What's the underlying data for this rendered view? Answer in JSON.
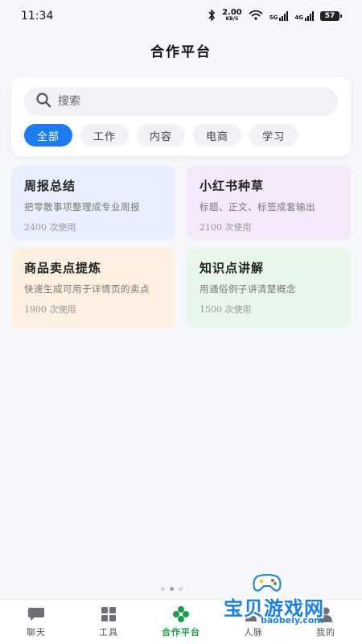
{
  "status_bar": {
    "time": "11:34",
    "net_speed": "2.00",
    "net_unit": "KB/S",
    "net_5g": "5G",
    "net_4g": "4G",
    "battery": "57"
  },
  "header": {
    "title": "合作平台"
  },
  "search": {
    "placeholder": "搜索",
    "value": ""
  },
  "filters": [
    {
      "label": "全部",
      "active": true
    },
    {
      "label": "工作",
      "active": false
    },
    {
      "label": "内容",
      "active": false
    },
    {
      "label": "电商",
      "active": false
    },
    {
      "label": "学习",
      "active": false
    }
  ],
  "cards": [
    {
      "title": "周报总结",
      "desc": "把零散事项整理成专业周报",
      "uses": "2400 次使用",
      "bg": "#e9efff"
    },
    {
      "title": "小红书种草",
      "desc": "标题、正文、标签成套输出",
      "uses": "2100 次使用",
      "bg": "#f3e9fb"
    },
    {
      "title": "商品卖点提炼",
      "desc": "快速生成可用于详情页的卖点",
      "uses": "1900 次使用",
      "bg": "#fdf0e1"
    },
    {
      "title": "知识点讲解",
      "desc": "用通俗例子讲清楚概念",
      "uses": "1500 次使用",
      "bg": "#e8f6ec"
    }
  ],
  "tabbar": [
    {
      "label": "聊天",
      "icon": "chat-icon",
      "active": false
    },
    {
      "label": "工具",
      "icon": "grid-icon",
      "active": false
    },
    {
      "label": "合作平台",
      "icon": "clover-icon",
      "active": true
    },
    {
      "label": "人脉",
      "icon": "people-icon",
      "active": false
    },
    {
      "label": "我的",
      "icon": "user-icon",
      "active": false
    }
  ],
  "watermark": {
    "text": "宝贝游戏网",
    "url": "baobeiy.com"
  },
  "colors": {
    "accent": "#1f7cf0",
    "active_tab": "#1a9b4a"
  }
}
